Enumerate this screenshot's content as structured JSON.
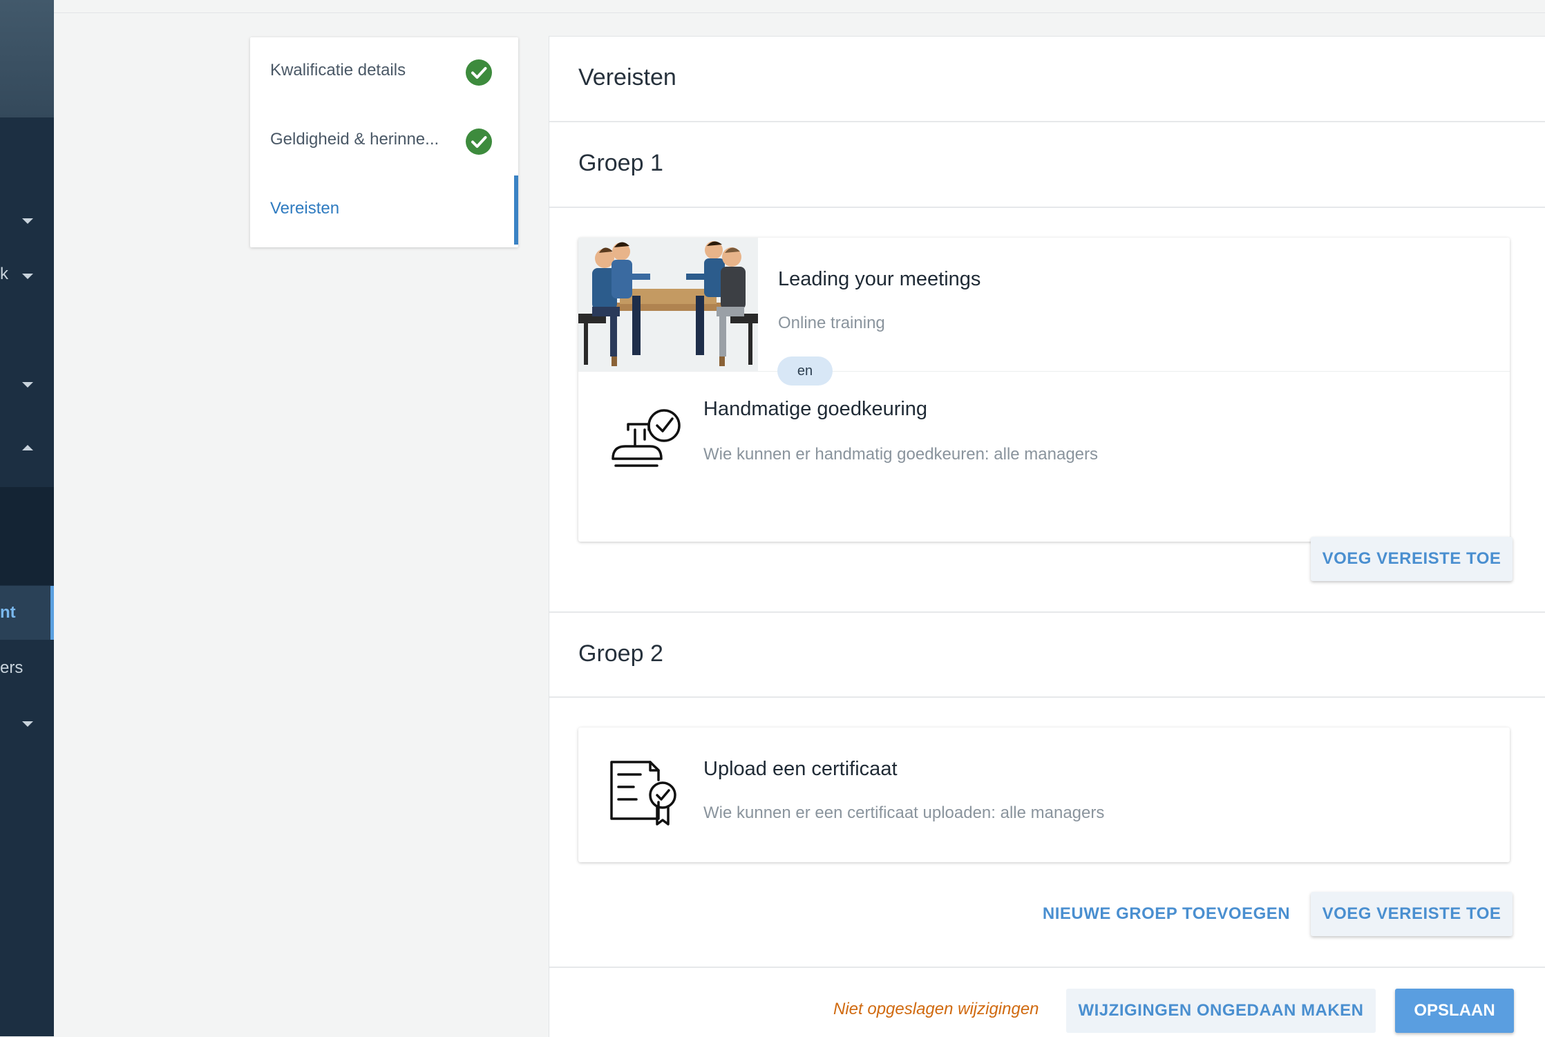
{
  "sidebar": {
    "items": [
      {
        "label": "",
        "caret": "down"
      },
      {
        "label": "k",
        "caret": "down"
      },
      {
        "label": "",
        "caret": "down"
      },
      {
        "label": "",
        "caret": "up"
      },
      {
        "label": "nt",
        "active": true
      },
      {
        "label": "ers"
      },
      {
        "label": "",
        "caret": "down"
      }
    ]
  },
  "steps": [
    {
      "label": "Kwalificatie details",
      "completed": true
    },
    {
      "label": "Geldigheid & herinne...",
      "completed": true
    },
    {
      "label": "Vereisten",
      "active": true
    }
  ],
  "main": {
    "title": "Vereisten",
    "groups": [
      {
        "title": "Groep 1",
        "requirements": [
          {
            "title": "Leading your meetings",
            "subtitle": "Online training",
            "icon": "meeting-illustration"
          },
          {
            "title": "Handmatige goedkeuring",
            "subtitle": "Wie kunnen er handmatig goedkeuren: alle managers",
            "icon": "stamp-approval-icon"
          }
        ],
        "connector": "en",
        "add_requirement_label": "VOEG VEREISTE TOE"
      },
      {
        "title": "Groep 2",
        "requirements": [
          {
            "title": "Upload een certificaat",
            "subtitle": "Wie kunnen er een certificaat uploaden: alle managers",
            "icon": "certificate-icon"
          }
        ],
        "new_group_label": "NIEUWE GROEP TOEVOEGEN",
        "add_requirement_label": "VOEG VEREISTE TOE"
      }
    ]
  },
  "footer": {
    "unsaved_text": "Niet opgeslagen wijzigingen",
    "undo_label": "WIJZIGINGEN ONGEDAAN MAKEN",
    "save_label": "OPSLAAN"
  },
  "colors": {
    "nav_bg": "#1c2f42",
    "accent": "#4a8fd0",
    "success": "#3d8b3d",
    "warning_text": "#d06a10"
  }
}
